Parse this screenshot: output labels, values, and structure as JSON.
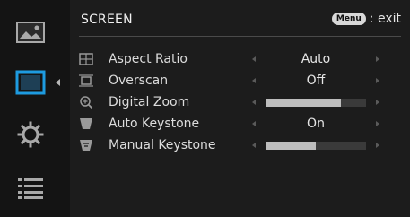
{
  "nav": {
    "items": [
      {
        "name": "picture",
        "icon": "image-icon",
        "selected": false
      },
      {
        "name": "screen",
        "icon": "monitor-icon",
        "selected": true
      },
      {
        "name": "setting",
        "icon": "gear-icon",
        "selected": false
      },
      {
        "name": "info",
        "icon": "list-icon",
        "selected": false
      }
    ]
  },
  "header": {
    "title": "SCREEN",
    "menu_key": "Menu",
    "menu_hint": ": exit"
  },
  "rows": [
    {
      "label": "Aspect Ratio",
      "icon": "aspect-ratio-icon",
      "type": "value",
      "value": "Auto"
    },
    {
      "label": "Overscan",
      "icon": "overscan-icon",
      "type": "value",
      "value": "Off"
    },
    {
      "label": "Digital Zoom",
      "icon": "zoom-icon",
      "type": "slider",
      "level": 0.75
    },
    {
      "label": "Auto Keystone",
      "icon": "keystone-icon",
      "type": "value",
      "value": "On"
    },
    {
      "label": "Manual Keystone",
      "icon": "manual-keystone-icon",
      "type": "slider",
      "level": 0.5
    }
  ],
  "colors": {
    "accent": "#1e9be0",
    "background": "#1c1c1c",
    "nav_background": "#141414",
    "slider_fill": "#bdbdbd",
    "slider_track": "#3a3a3a"
  }
}
